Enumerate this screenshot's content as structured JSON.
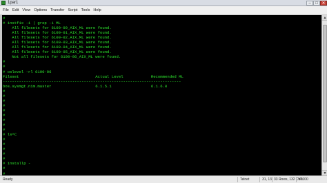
{
  "window": {
    "title": "1par1",
    "minimize_glyph": "–",
    "maximize_glyph": "□",
    "close_glyph": "✕"
  },
  "menubar": {
    "items": [
      "File",
      "Edit",
      "View",
      "Options",
      "Transfer",
      "Script",
      "Tools",
      "Help"
    ]
  },
  "terminal": {
    "text_color": "#2ee82e",
    "background": "#000000",
    "lines": [
      "#",
      "# instfix -i | grep -i ML",
      "    All filesets for 6100-00_AIX_ML were found.",
      "    All filesets for 6100-01_AIX_ML were found.",
      "    All filesets for 6100-02_AIX_ML were found.",
      "    All filesets for 6100-03_AIX_ML were found.",
      "    All filesets for 6100-04_AIX_ML were found.",
      "    All filesets for 6100-05_AIX_ML were found.",
      "    Not all filesets for 6100-06_AIX_ML were found.",
      "#",
      "#",
      "# oslevel -rl 6100-06",
      "Fileset                                 Actual Level            Recommended ML",
      "-----------------------------------------------------------------------------",
      "bos.sysmgt.nim.master                   6.1.5.1                 6.1.6.0",
      "#",
      "#",
      "#",
      "#",
      "#",
      "#",
      "#",
      "#",
      "#",
      "# ls^C",
      "#",
      "#",
      "#",
      "#",
      "#",
      "# installp -",
      "#",
      "#"
    ]
  },
  "scrollbar": {
    "up_glyph": "▲",
    "down_glyph": "▼"
  },
  "statusbar": {
    "ready": "Ready",
    "protocol": "Telnet",
    "position": "31, 13",
    "size": "33 Rows, 132 Cols",
    "terminal_type": "VT100"
  }
}
